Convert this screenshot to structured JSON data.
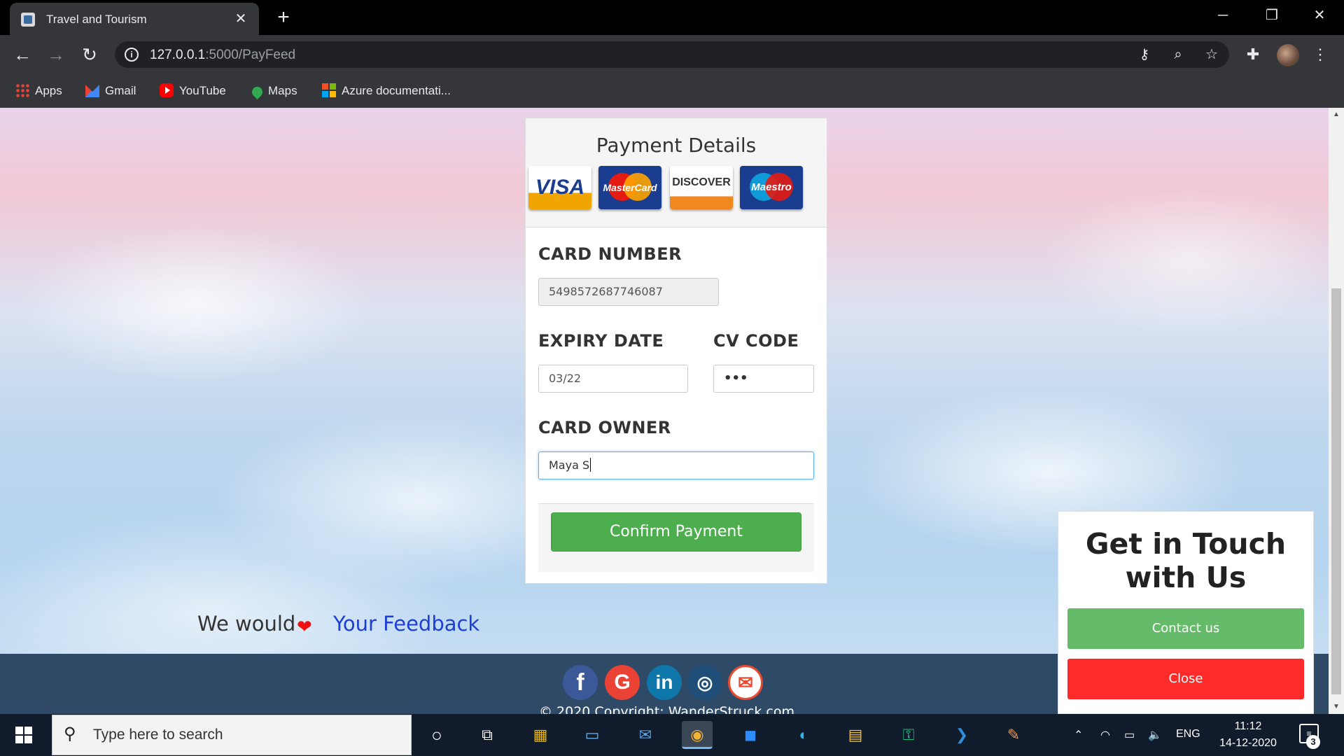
{
  "browser": {
    "tab_title": "Travel and Tourism",
    "tab_close": "✕",
    "new_tab": "+",
    "url_host": "127.0.0.1",
    "url_path": ":5000/PayFeed",
    "window_controls": {
      "minimize": "─",
      "restore": "❐",
      "close": "✕"
    },
    "bookmarks": [
      {
        "label": "Apps",
        "icon": "apps-grid-icon"
      },
      {
        "label": "Gmail",
        "icon": "gmail-icon"
      },
      {
        "label": "YouTube",
        "icon": "youtube-icon"
      },
      {
        "label": "Maps",
        "icon": "maps-icon"
      },
      {
        "label": "Azure documentati...",
        "icon": "microsoft-icon"
      }
    ]
  },
  "payment": {
    "title": "Payment Details",
    "cards": [
      "VISA",
      "MasterCard",
      "DISCOVER",
      "Maestro"
    ],
    "card_number_label": "CARD NUMBER",
    "card_number_value": "5498572687746087",
    "expiry_label": "EXPIRY DATE",
    "expiry_value": "03/22",
    "cv_label": "CV CODE",
    "cv_value": "•••",
    "owner_label": "CARD OWNER",
    "owner_value": "Maya S",
    "confirm_label": "Confirm Payment"
  },
  "feedback": {
    "prefix": "We would",
    "heart": "❤",
    "link": "Your Feedback"
  },
  "footer": {
    "social": [
      {
        "label": "f",
        "icon": "facebook-icon"
      },
      {
        "label": "G",
        "icon": "google-icon"
      },
      {
        "label": "in",
        "icon": "linkedin-icon"
      },
      {
        "label": "◎",
        "icon": "instagram-icon"
      },
      {
        "label": "✉",
        "icon": "email-icon"
      }
    ],
    "copyright": "© 2020 Copyright: WanderStruck.com"
  },
  "touch": {
    "title_line1": "Get in Touch",
    "title_line2": "with Us",
    "contact_label": "Contact us",
    "close_label": "Close"
  },
  "taskbar": {
    "search_placeholder": "Type here to search",
    "language": "ENG",
    "time": "11:12",
    "date": "14-12-2020",
    "notification_count": "3"
  }
}
